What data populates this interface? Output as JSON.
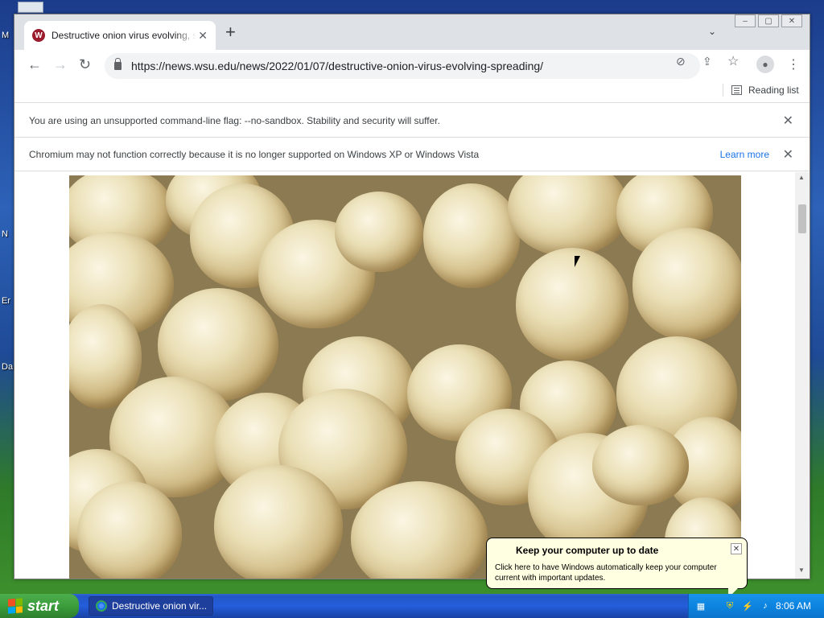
{
  "desktop": {
    "labels": [
      "M",
      "N",
      "Er",
      "Da"
    ]
  },
  "browser": {
    "tab": {
      "title": "Destructive onion virus evolving, spreading",
      "favicon_letter": "W",
      "close_glyph": "✕"
    },
    "new_tab_glyph": "+",
    "tab_search_glyph": "⌄",
    "window_buttons": [
      "–",
      "▢",
      "✕"
    ],
    "nav": {
      "back_glyph": "←",
      "forward_glyph": "→",
      "reload_glyph": "↻"
    },
    "url": "https://news.wsu.edu/news/2022/01/07/destructive-onion-virus-evolving-spreading/",
    "omnibox_icons": [
      "eye-slash-icon",
      "share-icon",
      "star-icon"
    ],
    "omnibox_glyphs": [
      "⊘",
      "⇪",
      "☆"
    ],
    "avatar_glyph": "●",
    "menu_glyph": "⋮",
    "reading_list_label": "Reading list"
  },
  "infobars": [
    {
      "text": "You are using an unsupported command-line flag: --no-sandbox. Stability and security will suffer."
    },
    {
      "text": "Chromium may not function correctly because it is no longer supported on Windows XP or Windows Vista",
      "link": "Learn more"
    }
  ],
  "scrollbar": {
    "up_glyph": "▲",
    "down_glyph": "▼"
  },
  "balloon": {
    "title": "Keep your computer up to date",
    "body": "Click here to have Windows automatically keep your computer current with important updates.",
    "close_glyph": "✕"
  },
  "taskbar": {
    "start_label": "start",
    "task_label": "Destructive onion vir...",
    "clock": "8:06 AM"
  },
  "colors": {
    "accent": "#1a73e8",
    "xp_start_green": "#3c9d3c",
    "taskbar_blue": "#245edb",
    "balloon_bg": "#ffffe1"
  }
}
